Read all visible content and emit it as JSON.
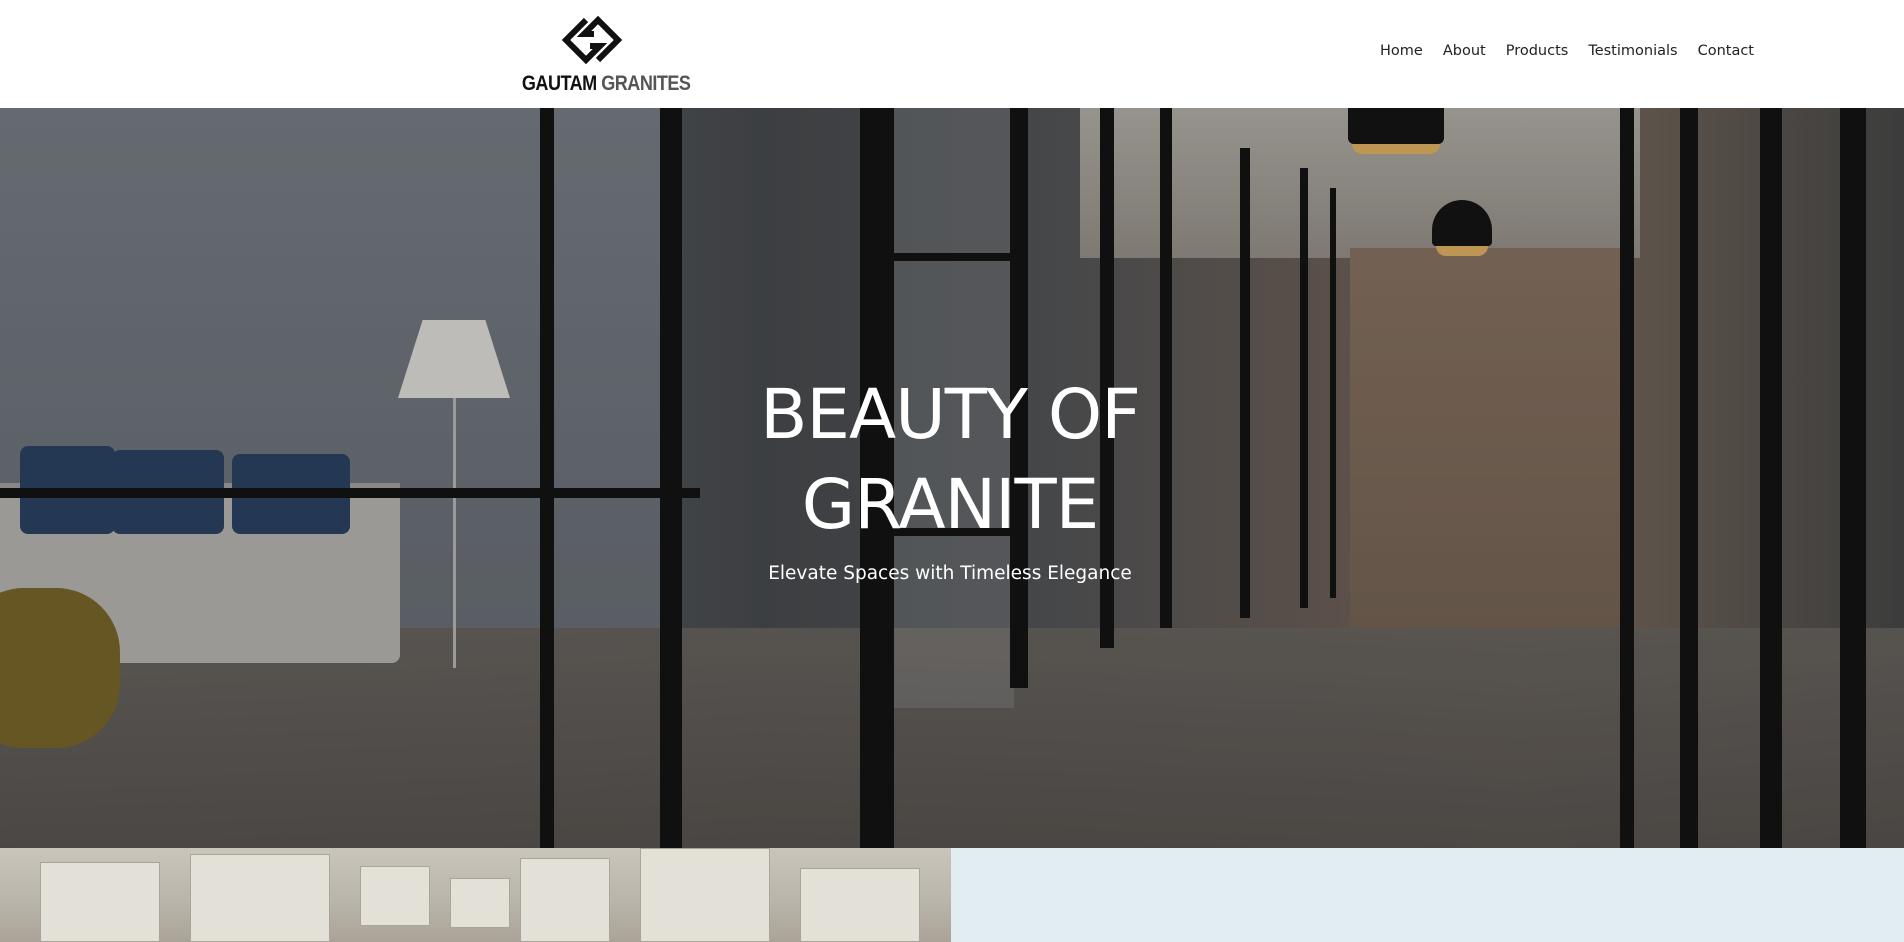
{
  "header": {
    "logo": {
      "word1": "GAUTAM",
      "word2": "GRANITES",
      "icon": "gg-monogram-icon"
    },
    "nav": [
      {
        "label": "Home"
      },
      {
        "label": "About"
      },
      {
        "label": "Products"
      },
      {
        "label": "Testimonials"
      },
      {
        "label": "Contact"
      }
    ]
  },
  "hero": {
    "title_line1": "BEAUTY OF",
    "title_line2": "GRANITE",
    "subtitle": "Elevate Spaces with Timeless Elegance"
  },
  "colors": {
    "header_bg": "#ffffff",
    "nav_text": "#222222",
    "hero_text": "#ffffff",
    "logo_dark": "#111111",
    "logo_grey": "#555555",
    "light_panel": "#e1edf1"
  }
}
